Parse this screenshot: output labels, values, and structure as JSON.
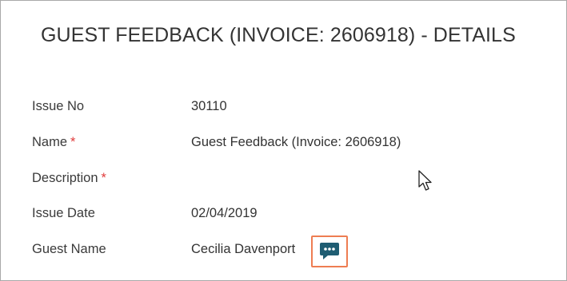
{
  "header": {
    "title": "GUEST FEEDBACK (INVOICE: 2606918) - DETAILS"
  },
  "fields": [
    {
      "label": "Issue No",
      "required": false,
      "value": "30110"
    },
    {
      "label": "Name",
      "required": true,
      "value": "Guest Feedback (Invoice: 2606918)"
    },
    {
      "label": "Description",
      "required": true,
      "value": ""
    },
    {
      "label": "Issue Date",
      "required": false,
      "value": "02/04/2019"
    },
    {
      "label": "Guest Name",
      "required": false,
      "value": "Cecilia Davenport"
    }
  ],
  "required_marker": "*",
  "icons": {
    "comment": "comment-dots-icon",
    "cursor": "mouse-pointer-icon"
  },
  "colors": {
    "required": "#e03b3b",
    "highlight_border": "#ee7d52",
    "comment_icon": "#1f5d72"
  }
}
